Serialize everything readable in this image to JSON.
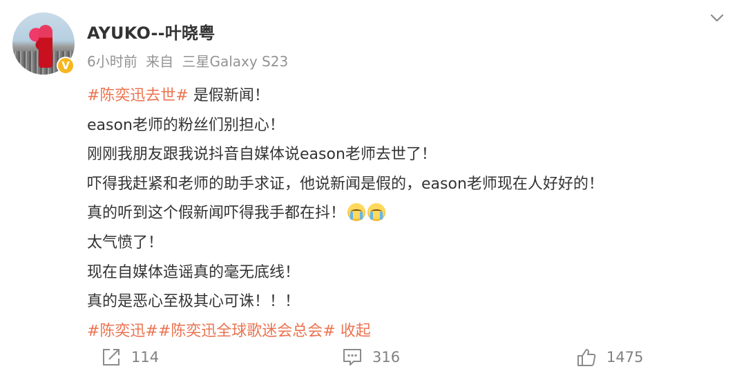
{
  "post": {
    "author": "AYUKO--叶晓粤",
    "time": "6小时前",
    "source_prefix": "来自",
    "device": "三星Galaxy S23",
    "lines": [
      [
        {
          "t": "#陈奕迅去世#",
          "h": true
        },
        {
          "t": " 是假新闻！",
          "h": false
        }
      ],
      [
        {
          "t": "eason老师的粉丝们别担心！",
          "h": false
        }
      ],
      [
        {
          "t": "刚刚我朋友跟我说抖音自媒体说eason老师去世了！",
          "h": false
        }
      ],
      [
        {
          "t": "吓得我赶紧和老师的助手求证，他说新闻是假的，eason老师现在人好好的！",
          "h": false
        }
      ],
      [
        {
          "t": "真的听到这个假新闻吓得我手都在抖！",
          "h": false
        },
        {
          "emoji": "crying-face-icon"
        },
        {
          "emoji": "crying-face-icon"
        }
      ],
      [
        {
          "t": "太气愤了！",
          "h": false
        }
      ],
      [
        {
          "t": "现在自媒体造谣真的毫无底线！",
          "h": false
        }
      ],
      [
        {
          "t": "真的是恶心至极其心可诛！！！",
          "h": false
        }
      ],
      [
        {
          "t": "#陈奕迅##陈奕迅全球歌迷会总会#",
          "h": true
        },
        {
          "t": " 收起",
          "h": true
        }
      ]
    ]
  },
  "actions": {
    "repost_count": "114",
    "comment_count": "316",
    "like_count": "1475"
  },
  "colors": {
    "hashtag": "#eb7350",
    "text": "#333333",
    "meta": "#939393",
    "verify_badge": "#f6b71e"
  }
}
